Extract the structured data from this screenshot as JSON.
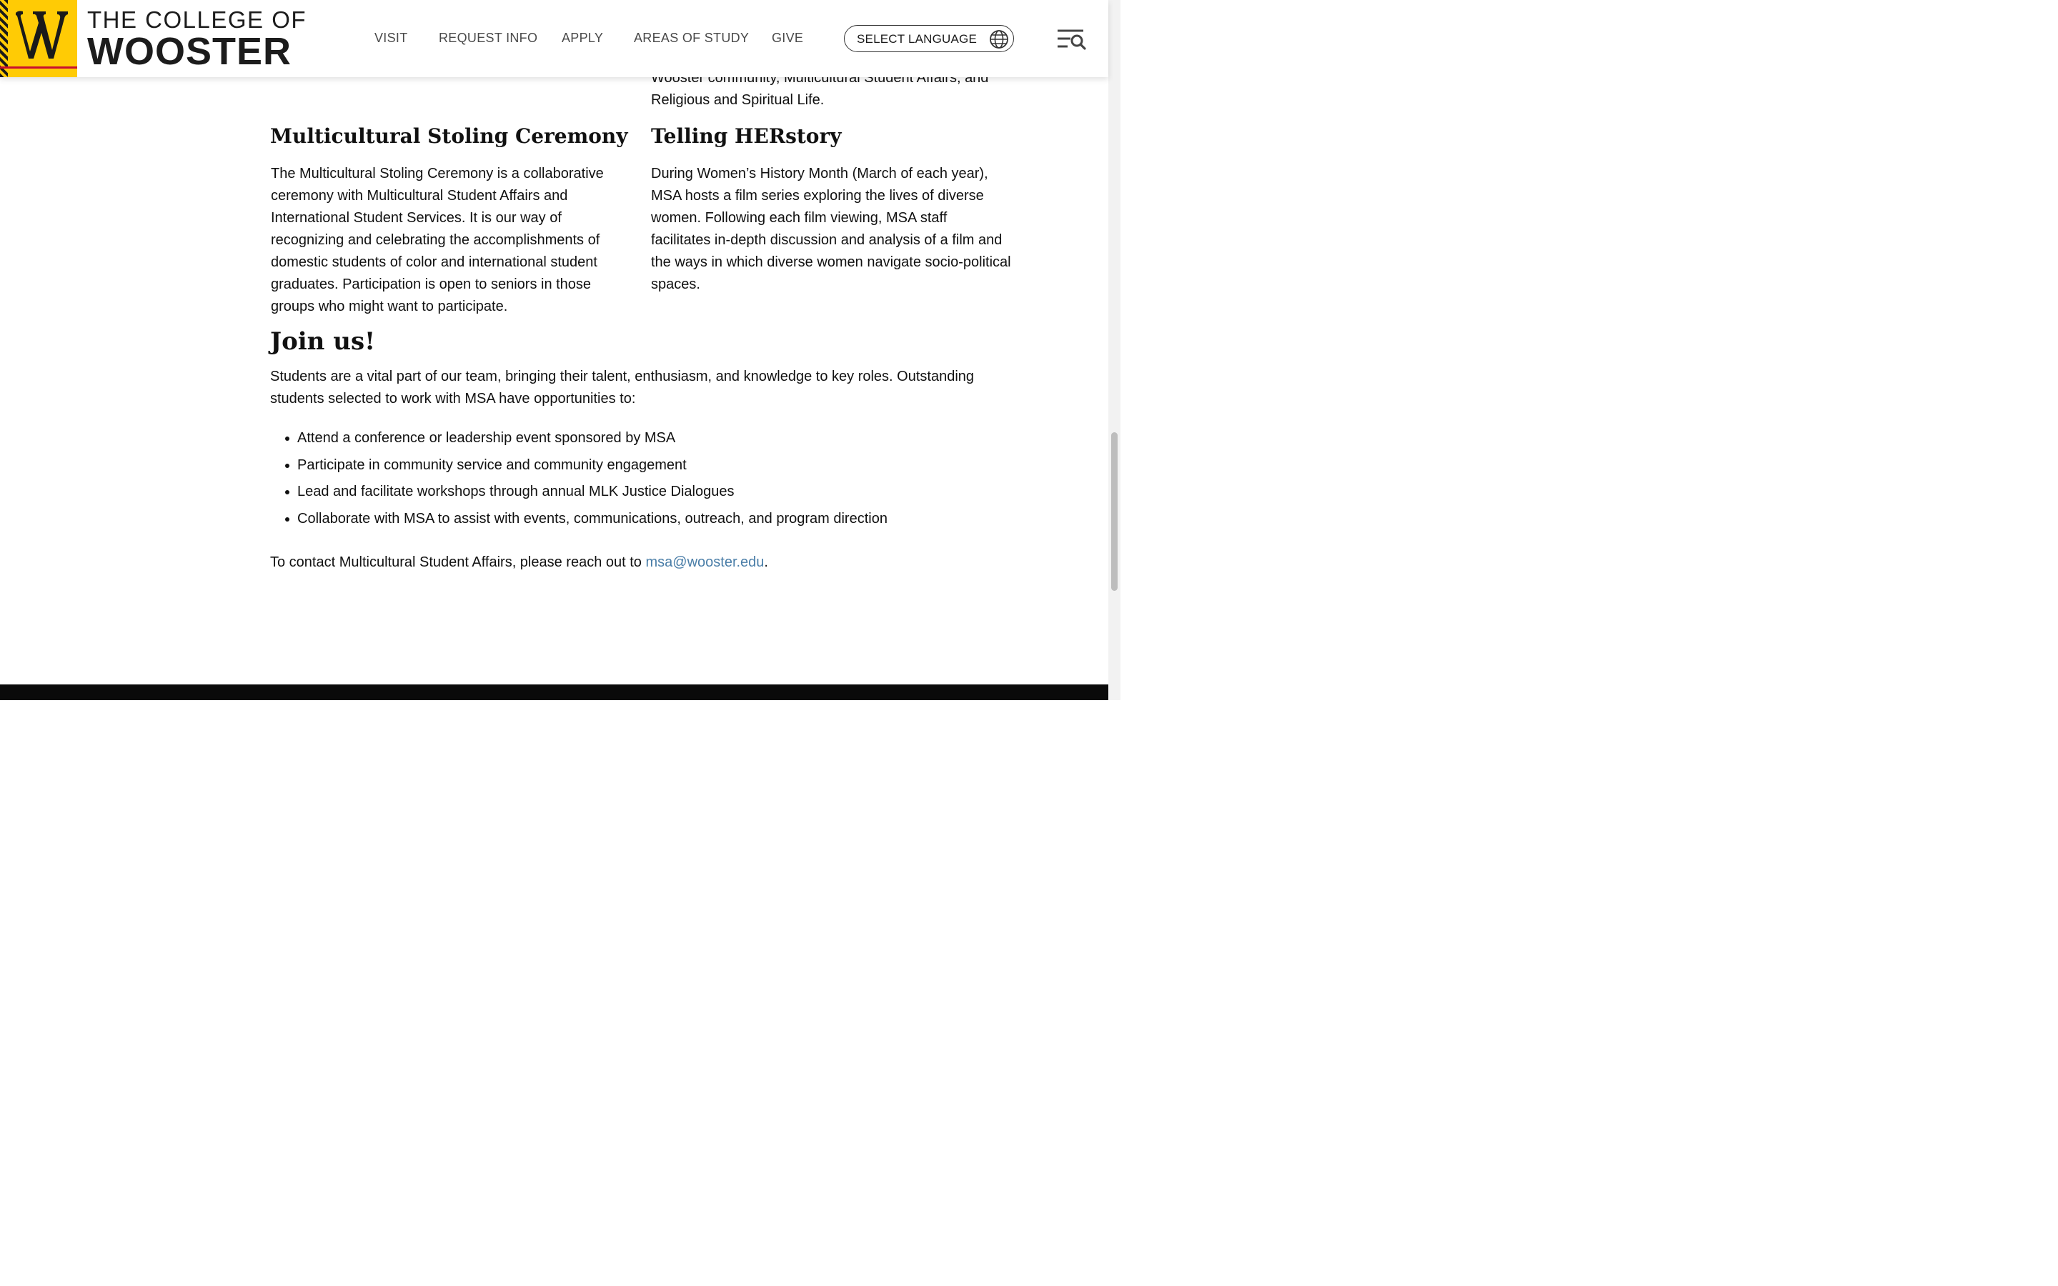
{
  "header": {
    "logo_line1": "THE COLLEGE OF",
    "logo_line2": "WOOSTER",
    "nav": [
      "VISIT",
      "REQUEST INFO",
      "APPLY",
      "AREAS OF STUDY",
      "GIVE"
    ],
    "language_label": "SELECT LANGUAGE",
    "colors": {
      "brand_yellow": "#ffcb05",
      "brand_black": "#1c1c1c",
      "brand_red": "#c8102e"
    }
  },
  "main": {
    "top_fragment_line1": "Wooster community, Multicultural Student Affairs, and",
    "top_fragment_line2": "Religious and Spiritual Life.",
    "left": {
      "title": "Multicultural Stoling Ceremony",
      "lines": [
        "The Multicultural Stoling Ceremony is a collaborative",
        "ceremony with Multicultural Student Affairs and",
        "International Student Services. It is our way of",
        "recognizing and celebrating the accomplishments of",
        "domestic students of color and international student",
        "graduates. Participation is open to seniors in those",
        "groups who might want to participate."
      ]
    },
    "right": {
      "title": "Telling HERstory",
      "lines": [
        "During Women’s History Month (March of each year),",
        "MSA hosts a film series exploring the lives of diverse",
        "women. Following each film viewing, MSA staff",
        "facilitates in-depth discussion and analysis of a film and",
        "the ways in which diverse women navigate socio-political",
        "spaces."
      ]
    },
    "join": {
      "title": "Join us!",
      "intro_line1": "Students are a vital part of our team, bringing their talent, enthusiasm, and knowledge to key roles. Outstanding",
      "intro_line2": "students selected to work with MSA have opportunities to:",
      "bullets": [
        "Attend a conference or leadership event sponsored by MSA",
        "Participate in community service and community engagement",
        "Lead and facilitate workshops through annual MLK Justice Dialogues",
        "Collaborate with MSA to assist with events, communications, outreach, and program direction"
      ]
    },
    "contact": {
      "prefix": "To contact Multicultural Student Affairs, please reach out to ",
      "email": "msa@wooster.edu",
      "suffix": ".",
      "link_color": "#4a7ea8"
    }
  },
  "icons": {
    "logo": "wooster-w-logo-icon",
    "language": "globe-icon",
    "menu": "menu-search-icon"
  }
}
